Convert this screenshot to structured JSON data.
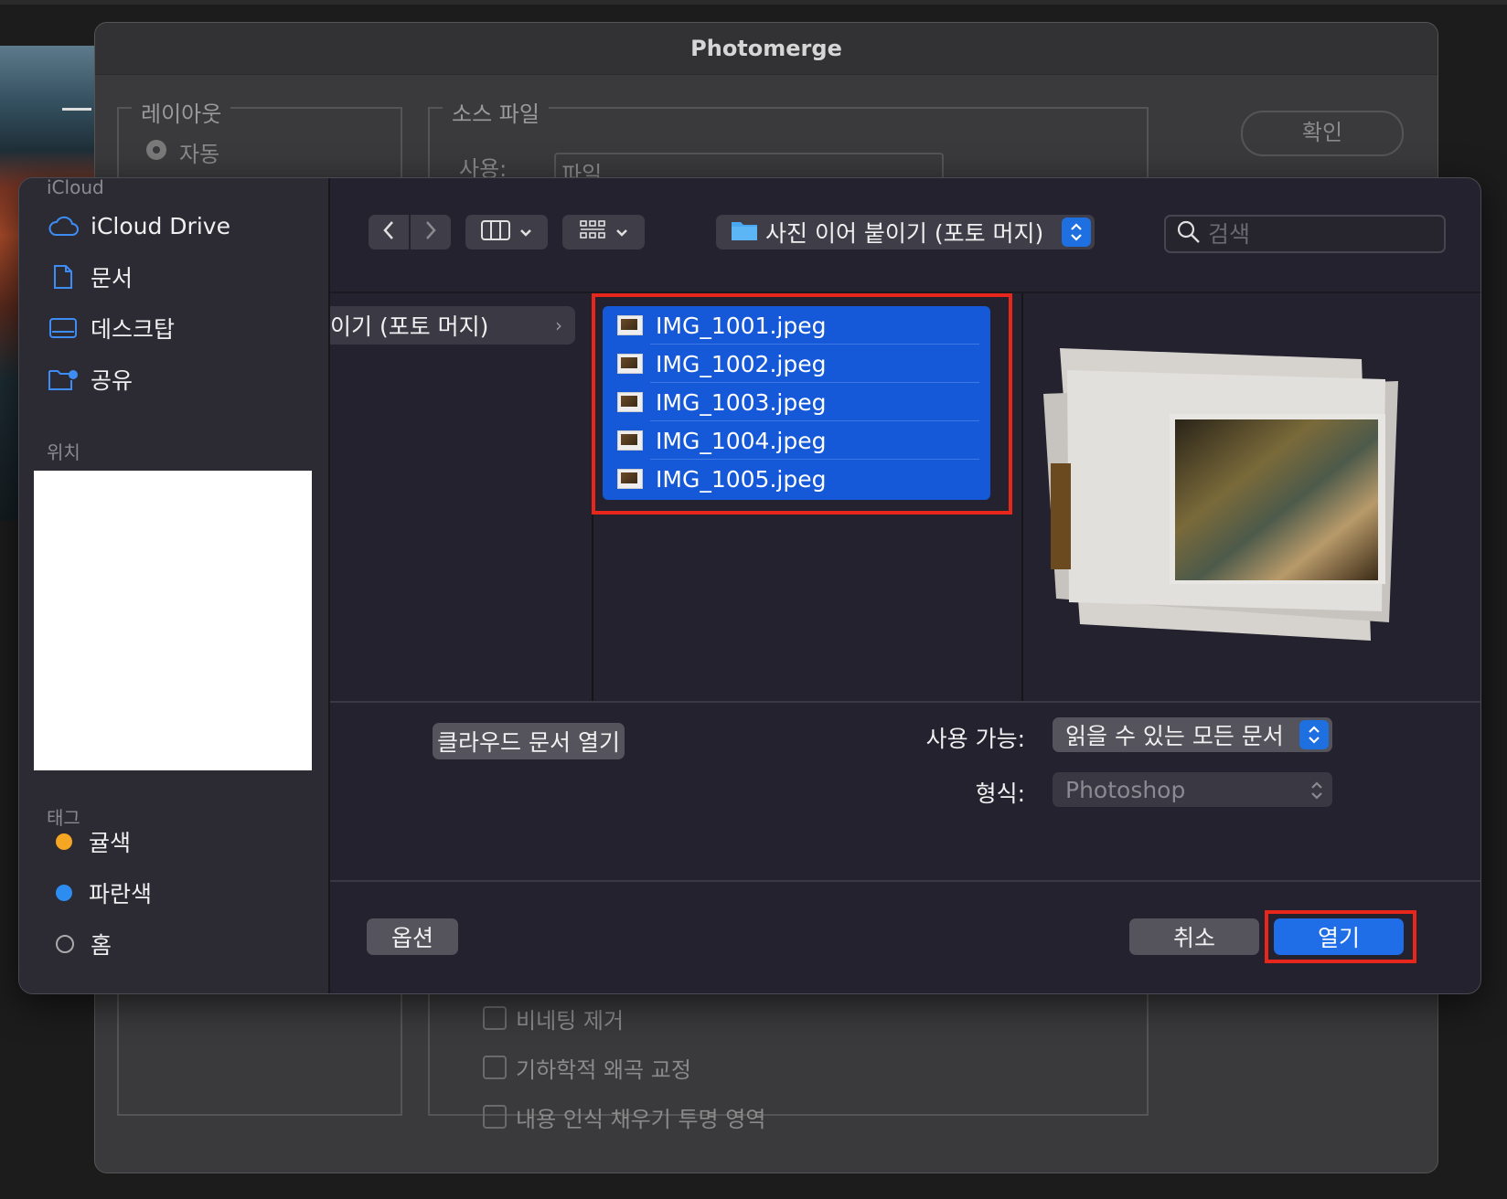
{
  "photomerge": {
    "title": "Photomerge",
    "layout_legend": "레이아웃",
    "layout_auto": "자동",
    "source_legend": "소스 파일",
    "use_label": "사용:",
    "use_value": "파일",
    "ok_label": "확인",
    "options": [
      "비네팅 제거",
      "기하학적 왜곡 교정",
      "내용 인식 채우기 투명 영역"
    ]
  },
  "sidebar": {
    "icloud_header": "iCloud",
    "icloud_items": [
      {
        "label": "iCloud Drive",
        "icon": "cloud-icon"
      },
      {
        "label": "문서",
        "icon": "document-icon"
      },
      {
        "label": "데스크탑",
        "icon": "desktop-icon"
      },
      {
        "label": "공유",
        "icon": "shared-folder-icon"
      }
    ],
    "locations_header": "위치",
    "tags_header": "태그",
    "tags": [
      {
        "label": "귤색",
        "color": "#f5a623"
      },
      {
        "label": "파란색",
        "color": "#2d8cf0"
      },
      {
        "label": "홈",
        "color": ""
      }
    ]
  },
  "toolbar": {
    "current_folder": "사진 이어 붙이기 (포토 머지)",
    "search_placeholder": "검색"
  },
  "browser": {
    "parent_column_item": "이기 (포토 머지)",
    "files": [
      "IMG_1001.jpeg",
      "IMG_1002.jpeg",
      "IMG_1003.jpeg",
      "IMG_1004.jpeg",
      "IMG_1005.jpeg"
    ]
  },
  "options": {
    "cloud_button": "클라우드 문서 열기",
    "enable_label": "사용 가능:",
    "enable_value": "읽을 수 있는 모든 문서",
    "format_label": "형식:",
    "format_value": "Photoshop"
  },
  "footer": {
    "options_button": "옵션",
    "cancel_button": "취소",
    "open_button": "열기"
  },
  "colors": {
    "accent": "#1f6ee8",
    "selection": "#1559d8",
    "highlight": "#e8271c"
  }
}
